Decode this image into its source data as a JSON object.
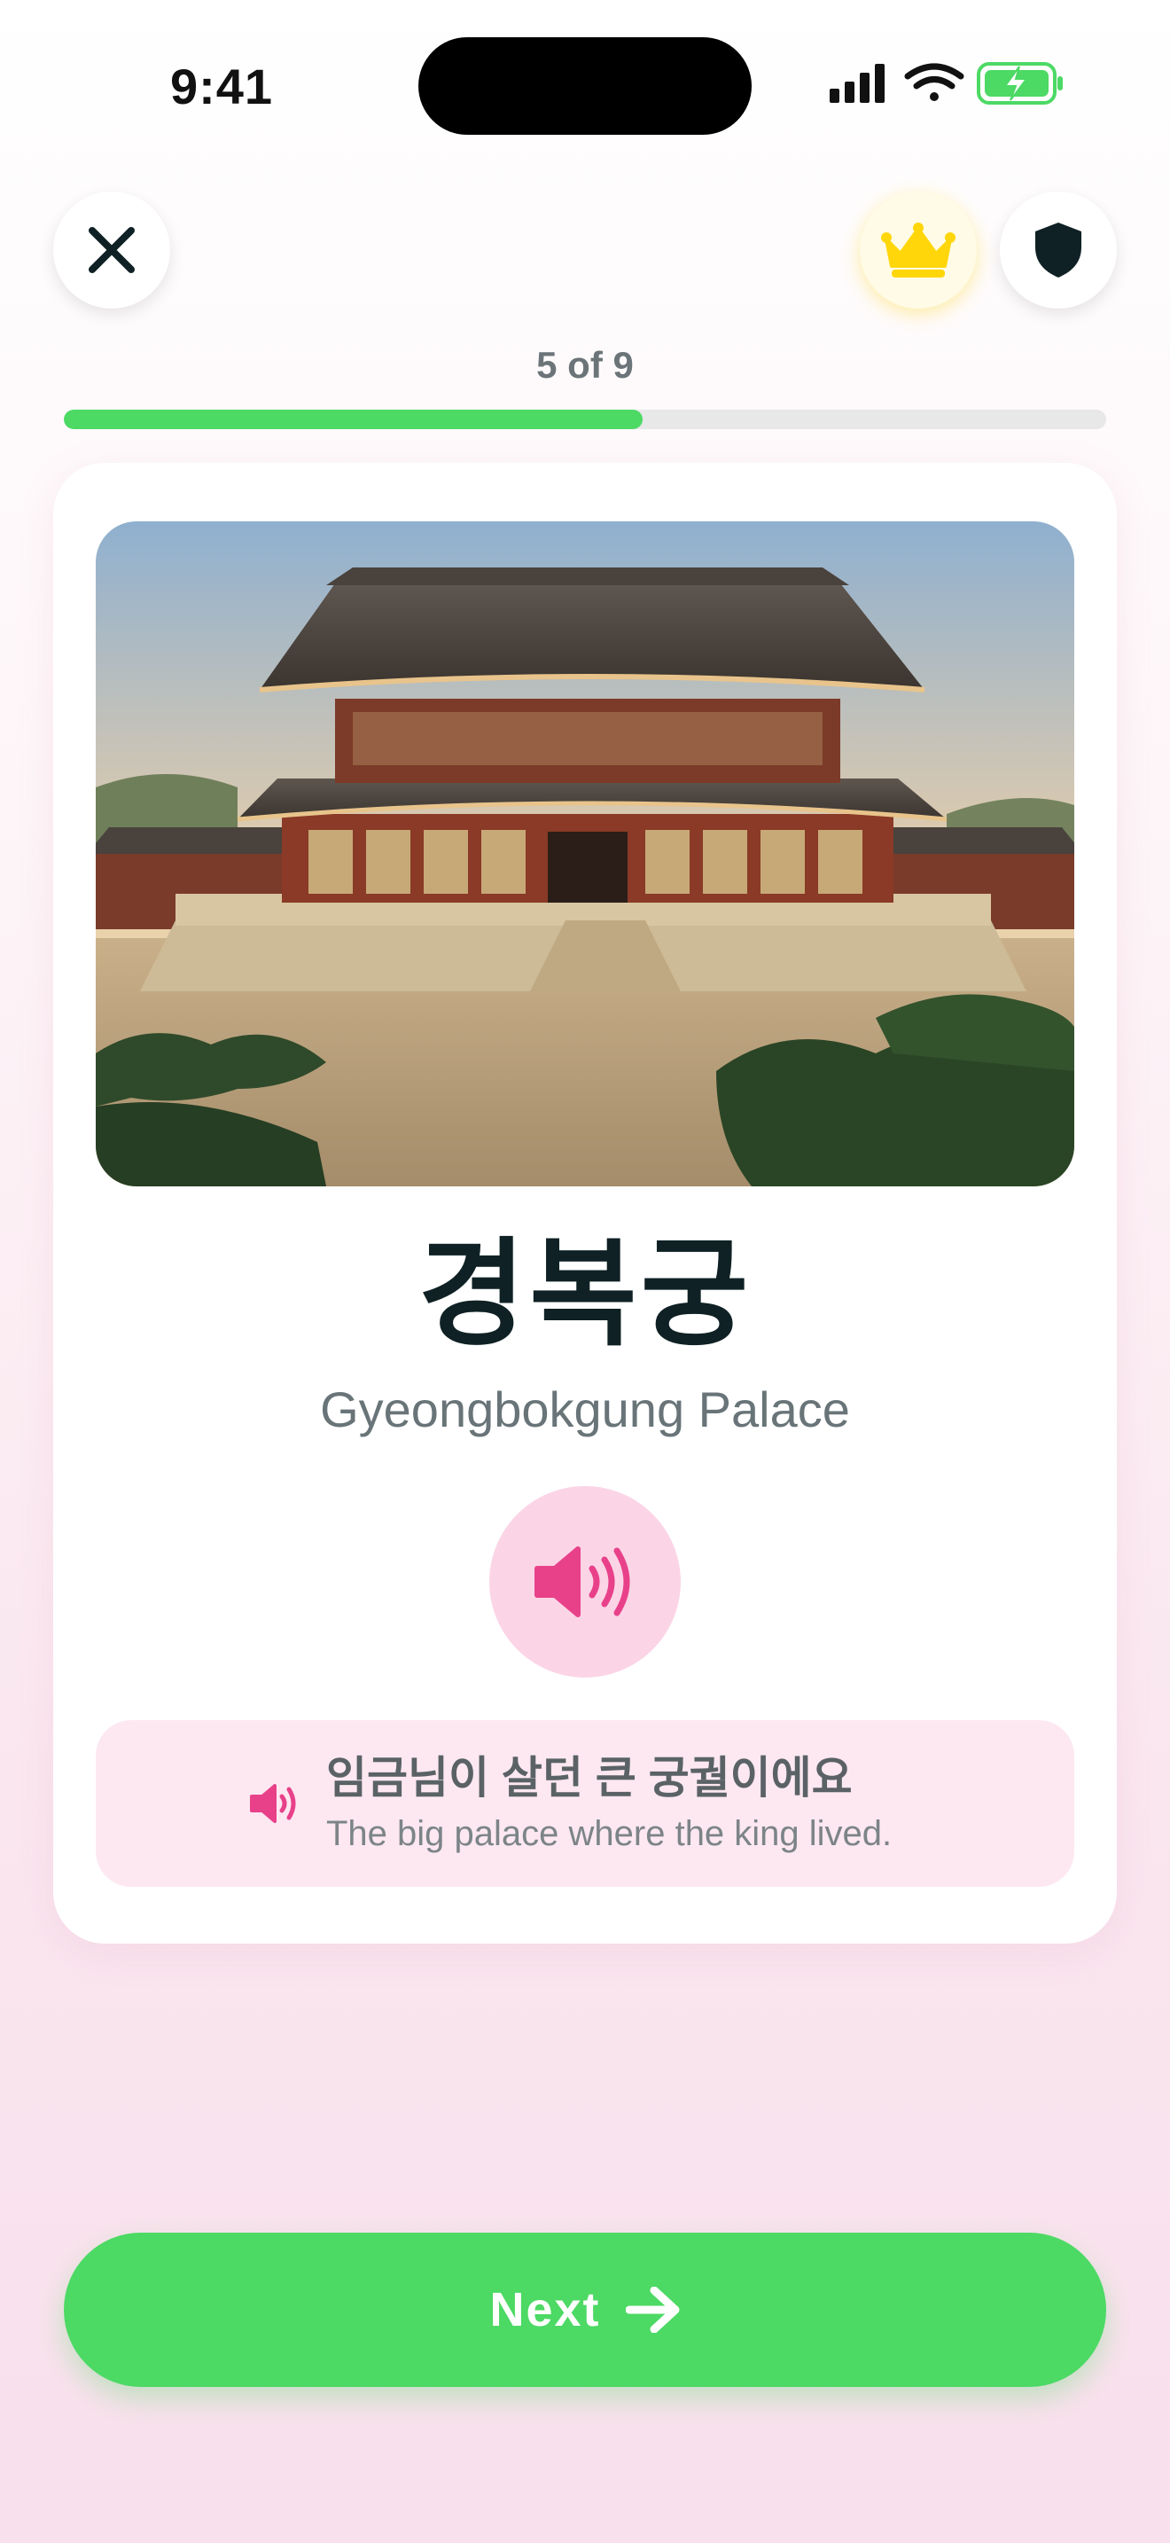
{
  "status_bar": {
    "time": "9:41"
  },
  "top_bar": {
    "close_icon": "close-icon",
    "crown_icon": "crown-icon",
    "shield_icon": "shield-icon"
  },
  "progress": {
    "label": "5 of 9",
    "current": 5,
    "total": 9,
    "fill_fraction": 0.555
  },
  "card": {
    "image_description_icon": "palace-photo",
    "word": "경복궁",
    "transliteration": "Gyeongbokgung Palace",
    "audio_icon": "speaker-icon",
    "example": {
      "korean": "임금님이 살던 큰 궁궐이에요",
      "english": "The big palace where the king lived."
    }
  },
  "footer": {
    "next_label": "Next"
  },
  "colors": {
    "accent_green": "#4cd964",
    "accent_pink": "#e8418a",
    "pink_soft": "#fbd5e6",
    "crown_yellow": "#ffd60a",
    "text_dark": "#0f2124"
  }
}
